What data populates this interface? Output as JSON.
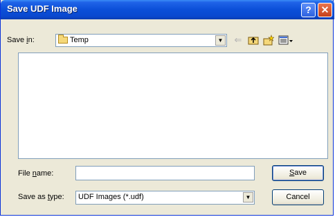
{
  "window": {
    "title": "Save UDF Image",
    "help_glyph": "?",
    "close_glyph": "✕"
  },
  "toolbar": {
    "save_in_label_prefix": "Save ",
    "save_in_label_mnemonic": "i",
    "save_in_label_suffix": "n:",
    "save_in_value": "Temp",
    "icons": [
      "back-icon",
      "up-folder-icon",
      "new-folder-icon",
      "view-menu-icon"
    ]
  },
  "form": {
    "file_name_label_prefix": "File ",
    "file_name_label_mnemonic": "n",
    "file_name_label_suffix": "ame:",
    "file_name_value": "",
    "save_as_label_prefix": "Save as ",
    "save_as_label_mnemonic": "t",
    "save_as_label_suffix": "ype:",
    "save_as_value": "UDF Images (*.udf)"
  },
  "buttons": {
    "save_mnemonic": "S",
    "save_rest": "ave",
    "cancel": "Cancel"
  }
}
